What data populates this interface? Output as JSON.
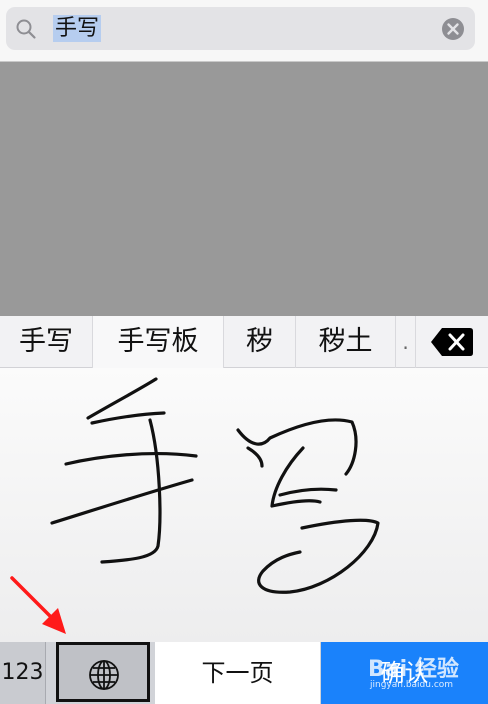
{
  "search": {
    "query": "手写"
  },
  "candidates": {
    "items": [
      "手写",
      "手写板",
      "秽",
      "秽土"
    ],
    "more": "."
  },
  "keys": {
    "numbers_label": "123",
    "globe_icon": "globe-icon",
    "next_page_label": "下一页",
    "confirm_label": "确认"
  },
  "colors": {
    "confirm_blue": "#1a82fb",
    "selection_highlight": "#b6cdef",
    "dim_overlay": "#999999",
    "annotation_red": "#ff1a1a"
  },
  "watermark": {
    "logo_text": "Bai 经验",
    "url": "jingyan.baidu.com"
  }
}
